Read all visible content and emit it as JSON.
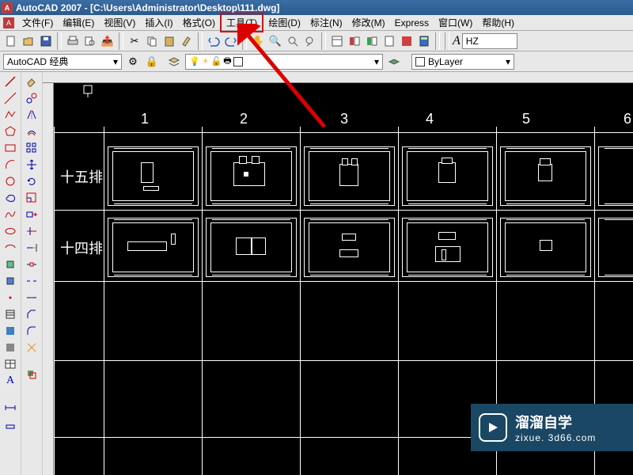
{
  "title": "AutoCAD 2007 - [C:\\Users\\Administrator\\Desktop\\111.dwg]",
  "menu": {
    "file": "文件(F)",
    "edit": "编辑(E)",
    "view": "视图(V)",
    "insert": "插入(I)",
    "format": "格式(O)",
    "tools": "工具(T)",
    "draw": "绘图(D)",
    "dimension": "标注(N)",
    "modify": "修改(M)",
    "express": "Express",
    "window": "窗口(W)",
    "help": "帮助(H)"
  },
  "toolbar1": {
    "icons": [
      "new",
      "open",
      "save",
      "plot",
      "preview",
      "publish",
      "cut",
      "copy",
      "paste",
      "match",
      "undo",
      "redo",
      "pan",
      "zoom",
      "zoom-prev",
      "properties",
      "design",
      "tool-palettes",
      "calc",
      "help"
    ]
  },
  "textstyle": {
    "label": "A",
    "value": "HZ"
  },
  "workspace": {
    "value": "AutoCAD 经典"
  },
  "layer": {
    "value": ""
  },
  "color": {
    "value": "ByLayer"
  },
  "columns": [
    "1",
    "2",
    "3",
    "4",
    "5",
    "6"
  ],
  "rows": {
    "r1": "十五排",
    "r2": "十四排"
  },
  "watermark": {
    "name": "溜溜自学",
    "url": "zixue. 3d66.com"
  }
}
